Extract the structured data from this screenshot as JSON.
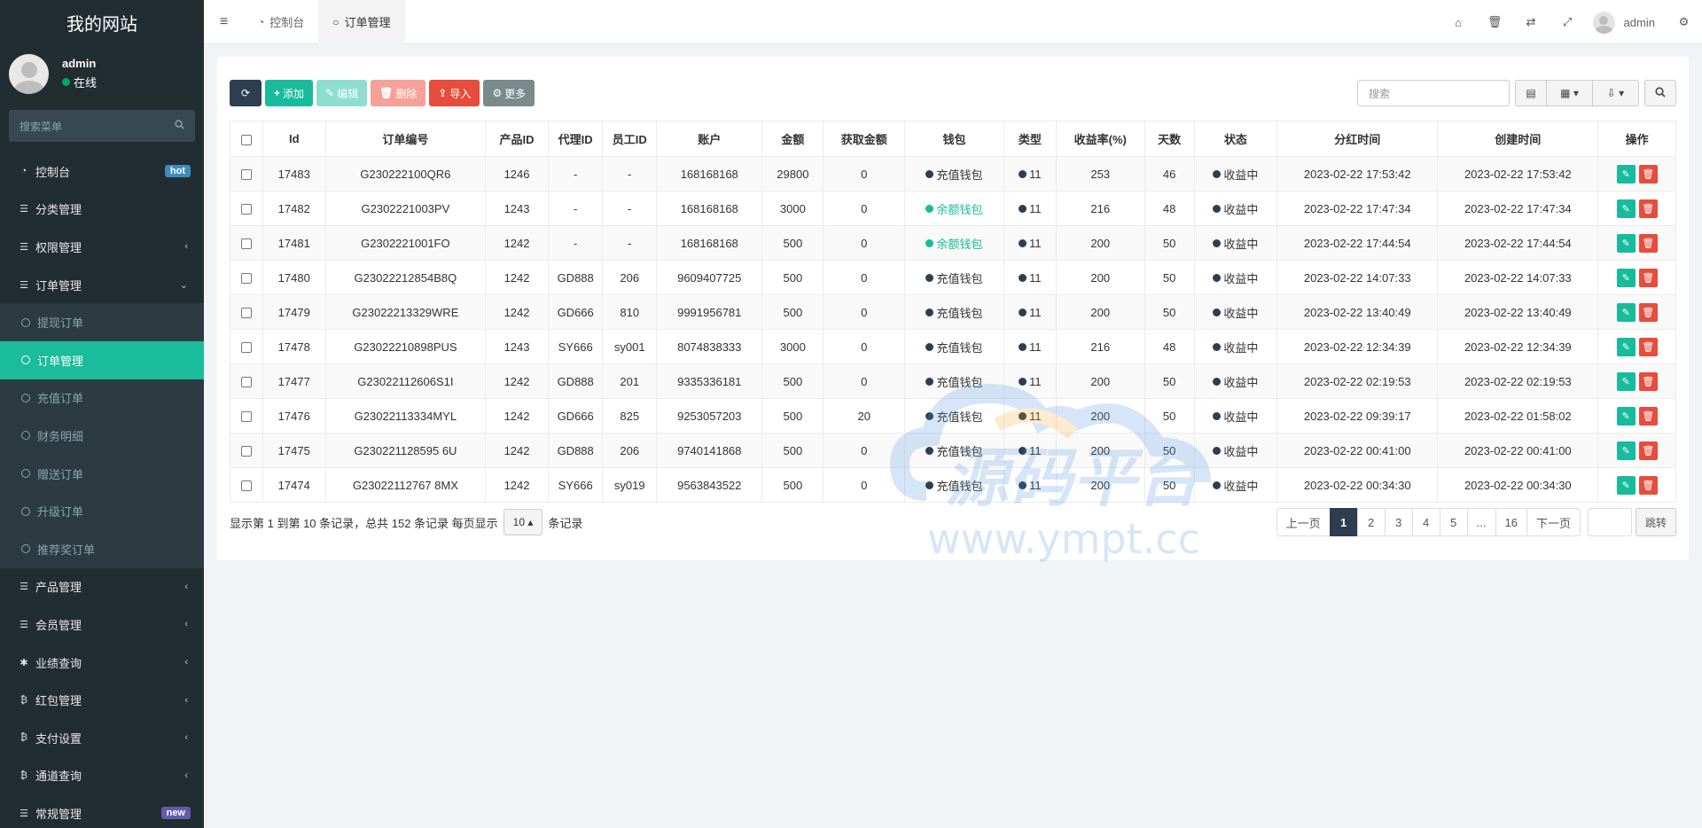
{
  "site_title": "我的网站",
  "user": {
    "name": "admin",
    "status": "在线",
    "status_color": "#00a65a"
  },
  "sidebar_search_placeholder": "搜索菜单",
  "menu": [
    {
      "label": "控制台",
      "icon": "dashboard-icon",
      "badge": "hot",
      "badge_color": "#3c8dbc"
    },
    {
      "label": "分类管理",
      "icon": "list-icon"
    },
    {
      "label": "权限管理",
      "icon": "list-icon",
      "chevron": "‹"
    },
    {
      "label": "订单管理",
      "icon": "list-icon",
      "chevron": "⌄"
    }
  ],
  "submenu": [
    {
      "label": "提现订单"
    },
    {
      "label": "订单管理",
      "active": true
    },
    {
      "label": "充值订单"
    },
    {
      "label": "财务明细"
    },
    {
      "label": "赠送订单"
    },
    {
      "label": "升级订单"
    },
    {
      "label": "推荐奖订单"
    }
  ],
  "menu_after": [
    {
      "label": "产品管理",
      "icon": "list-icon",
      "chevron": "‹"
    },
    {
      "label": "会员管理",
      "icon": "list-icon",
      "chevron": "‹"
    },
    {
      "label": "业绩查询",
      "icon": "asterisk-icon",
      "chevron": "‹"
    },
    {
      "label": "红包管理",
      "icon": "bitcoin-icon",
      "chevron": "‹"
    },
    {
      "label": "支付设置",
      "icon": "bitcoin-icon",
      "chevron": "‹"
    },
    {
      "label": "通道查询",
      "icon": "bitcoin-icon",
      "chevron": "‹"
    },
    {
      "label": "常规管理",
      "icon": "list-icon",
      "badge": "new",
      "badge_color": "#605ca8"
    }
  ],
  "tabs": [
    {
      "label": "控制台",
      "icon": "dashboard-icon"
    },
    {
      "label": "订单管理",
      "icon": "circle-icon",
      "active": true
    }
  ],
  "header_user": "admin",
  "toolbar": {
    "add": "添加",
    "edit": "编辑",
    "delete": "删除",
    "import": "导入",
    "more": "更多",
    "search_placeholder": "搜索"
  },
  "columns": [
    "Id",
    "订单编号",
    "产品ID",
    "代理ID",
    "员工ID",
    "账户",
    "金额",
    "获取金额",
    "钱包",
    "类型",
    "收益率(%)",
    "天数",
    "状态",
    "分红时间",
    "创建时间",
    "操作"
  ],
  "rows": [
    {
      "id": "17483",
      "order": "G230222100QR6",
      "product": "1246",
      "agent": "-",
      "staff": "-",
      "account": "168168168",
      "amount": "29800",
      "got": "0",
      "wallet": "充值钱包",
      "wallet_type": "recharge",
      "type": "11",
      "rate": "253",
      "days": "46",
      "status": "收益中",
      "bonus_time": "2023-02-22 17:53:42",
      "create_time": "2023-02-22 17:53:42"
    },
    {
      "id": "17482",
      "order": "G2302221003PV",
      "product": "1243",
      "agent": "-",
      "staff": "-",
      "account": "168168168",
      "amount": "3000",
      "got": "0",
      "wallet": "余额钱包",
      "wallet_type": "balance",
      "type": "11",
      "rate": "216",
      "days": "48",
      "status": "收益中",
      "bonus_time": "2023-02-22 17:47:34",
      "create_time": "2023-02-22 17:47:34"
    },
    {
      "id": "17481",
      "order": "G2302221001FO",
      "product": "1242",
      "agent": "-",
      "staff": "-",
      "account": "168168168",
      "amount": "500",
      "got": "0",
      "wallet": "余额钱包",
      "wallet_type": "balance",
      "type": "11",
      "rate": "200",
      "days": "50",
      "status": "收益中",
      "bonus_time": "2023-02-22 17:44:54",
      "create_time": "2023-02-22 17:44:54"
    },
    {
      "id": "17480",
      "order": "G23022212854B8Q",
      "product": "1242",
      "agent": "GD888",
      "staff": "206",
      "account": "9609407725",
      "amount": "500",
      "got": "0",
      "wallet": "充值钱包",
      "wallet_type": "recharge",
      "type": "11",
      "rate": "200",
      "days": "50",
      "status": "收益中",
      "bonus_time": "2023-02-22 14:07:33",
      "create_time": "2023-02-22 14:07:33"
    },
    {
      "id": "17479",
      "order": "G23022213329WRE",
      "product": "1242",
      "agent": "GD666",
      "staff": "810",
      "account": "9991956781",
      "amount": "500",
      "got": "0",
      "wallet": "充值钱包",
      "wallet_type": "recharge",
      "type": "11",
      "rate": "200",
      "days": "50",
      "status": "收益中",
      "bonus_time": "2023-02-22 13:40:49",
      "create_time": "2023-02-22 13:40:49"
    },
    {
      "id": "17478",
      "order": "G23022210898PUS",
      "product": "1243",
      "agent": "SY666",
      "staff": "sy001",
      "account": "8074838333",
      "amount": "3000",
      "got": "0",
      "wallet": "充值钱包",
      "wallet_type": "recharge",
      "type": "11",
      "rate": "216",
      "days": "48",
      "status": "收益中",
      "bonus_time": "2023-02-22 12:34:39",
      "create_time": "2023-02-22 12:34:39"
    },
    {
      "id": "17477",
      "order": "G23022112606S1I",
      "product": "1242",
      "agent": "GD888",
      "staff": "201",
      "account": "9335336181",
      "amount": "500",
      "got": "0",
      "wallet": "充值钱包",
      "wallet_type": "recharge",
      "type": "11",
      "rate": "200",
      "days": "50",
      "status": "收益中",
      "bonus_time": "2023-02-22 02:19:53",
      "create_time": "2023-02-22 02:19:53"
    },
    {
      "id": "17476",
      "order": "G23022113334MYL",
      "product": "1242",
      "agent": "GD666",
      "staff": "825",
      "account": "9253057203",
      "amount": "500",
      "got": "20",
      "wallet": "充值钱包",
      "wallet_type": "recharge",
      "type": "11",
      "rate": "200",
      "days": "50",
      "status": "收益中",
      "bonus_time": "2023-02-22 09:39:17",
      "create_time": "2023-02-22 01:58:02"
    },
    {
      "id": "17475",
      "order": "G230221128595 6U",
      "product": "1242",
      "agent": "GD888",
      "staff": "206",
      "account": "9740141868",
      "amount": "500",
      "got": "0",
      "wallet": "充值钱包",
      "wallet_type": "recharge",
      "type": "11",
      "rate": "200",
      "days": "50",
      "status": "收益中",
      "bonus_time": "2023-02-22 00:41:00",
      "create_time": "2023-02-22 00:41:00"
    },
    {
      "id": "17474",
      "order": "G23022112767 8MX",
      "product": "1242",
      "agent": "SY666",
      "staff": "sy019",
      "account": "9563843522",
      "amount": "500",
      "got": "0",
      "wallet": "充值钱包",
      "wallet_type": "recharge",
      "type": "11",
      "rate": "200",
      "days": "50",
      "status": "收益中",
      "bonus_time": "2023-02-22 00:34:30",
      "create_time": "2023-02-22 00:34:30"
    }
  ],
  "colors": {
    "recharge": "#2c3e50",
    "balance": "#18bc9c",
    "status_dot": "#2c3e50",
    "type_dot": "#2c3e50"
  },
  "footer": {
    "info": "显示第 1 到第 10 条记录，总共 152 条记录 每页显示",
    "page_size": "10",
    "suffix": "条记录"
  },
  "pagination": {
    "prev": "上一页",
    "pages": [
      "1",
      "2",
      "3",
      "4",
      "5",
      "...",
      "16"
    ],
    "active": "1",
    "next": "下一页",
    "jump": "跳转"
  },
  "watermark": {
    "text": "源码平台",
    "url": "www.ympt.cc"
  }
}
